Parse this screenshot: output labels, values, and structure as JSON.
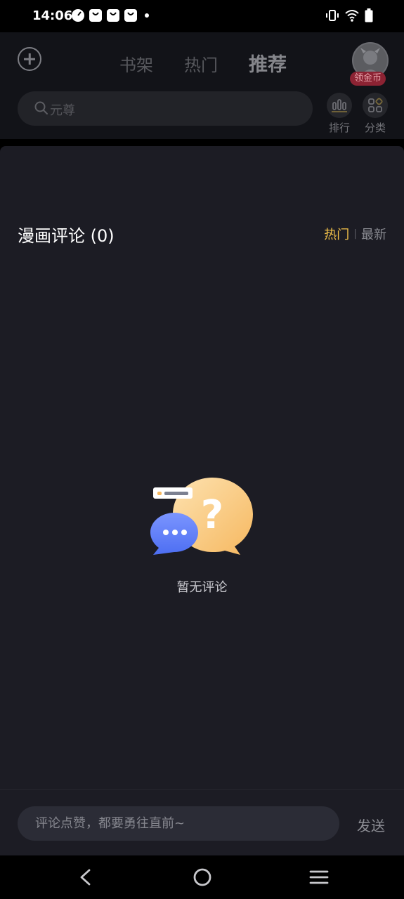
{
  "status_bar": {
    "time": "14:06"
  },
  "header": {
    "tabs": [
      "书架",
      "热门",
      "推荐"
    ],
    "active_tab": "推荐",
    "avatar_badge": "领金币",
    "search_placeholder": "元尊",
    "quick_actions": [
      {
        "label": "排行",
        "icon": "ranking-icon"
      },
      {
        "label": "分类",
        "icon": "category-icon"
      }
    ]
  },
  "comments": {
    "title": "漫画评论 (0)",
    "sort_hot": "热门",
    "sort_separator": "|",
    "sort_new": "最新",
    "empty_text": "暂无评论",
    "input_placeholder": "评论点赞，都要勇往直前~",
    "send_label": "发送"
  },
  "colors": {
    "accent_yellow": "#f2c149",
    "badge_red": "#8c2333",
    "sheet_bg": "#1c1c24"
  }
}
